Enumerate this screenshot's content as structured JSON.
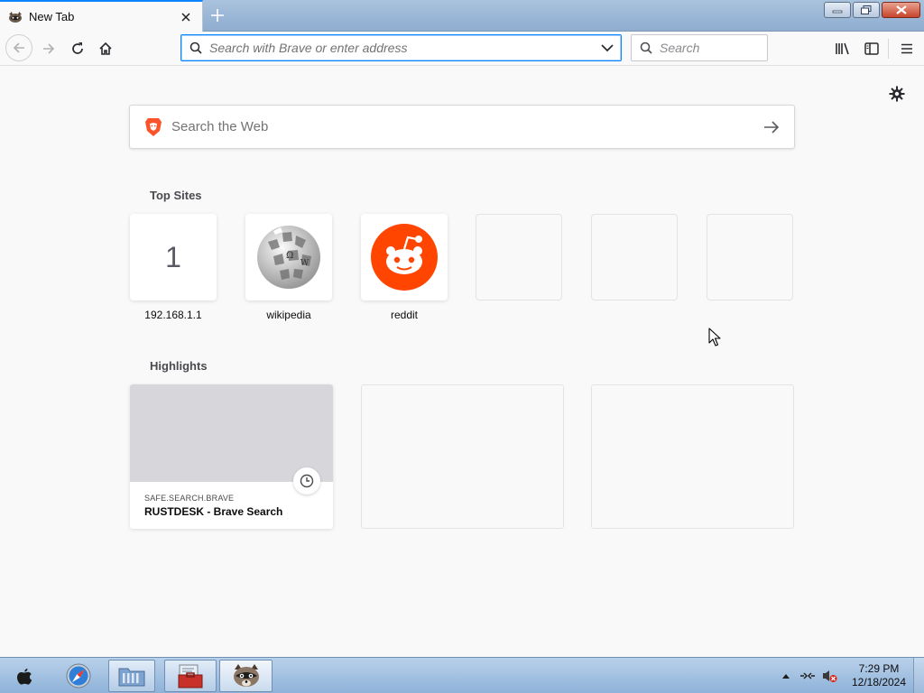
{
  "browser": {
    "tab": {
      "title": "New Tab"
    },
    "urlbar": {
      "placeholder": "Search with Brave or enter address"
    },
    "searchbar": {
      "placeholder": "Search"
    }
  },
  "newtab": {
    "web_search": {
      "placeholder": "Search the Web"
    },
    "top_sites": {
      "title": "Top Sites",
      "items": [
        {
          "label": "192.168.1.1",
          "icon": "letter-icon",
          "letter": "1"
        },
        {
          "label": "wikipedia",
          "icon": "wikipedia-globe-icon"
        },
        {
          "label": "reddit",
          "icon": "reddit-icon"
        },
        {
          "label": "",
          "icon": ""
        },
        {
          "label": "",
          "icon": ""
        },
        {
          "label": "",
          "icon": ""
        }
      ]
    },
    "highlights": {
      "title": "Highlights",
      "items": [
        {
          "hostname": "SAFE.SEARCH.BRAVE",
          "title": "RUSTDESK - Brave Search",
          "icon": "clock-icon"
        }
      ]
    }
  },
  "taskbar": {
    "time": "7:29 PM",
    "date": "12/18/2024"
  },
  "colors": {
    "accent": "#0a84ff",
    "reddit": "#ff4500",
    "brave": "#fb542b"
  }
}
